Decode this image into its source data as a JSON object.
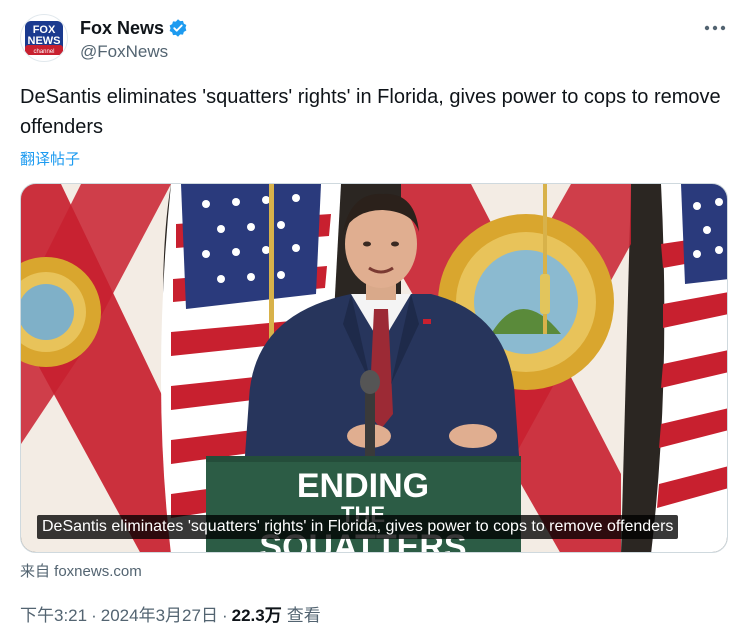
{
  "account": {
    "display_name": "Fox News",
    "handle": "@FoxNews",
    "avatar_logo_lines": [
      "FOX",
      "NEWS",
      "channel"
    ]
  },
  "tweet": {
    "text": "DeSantis eliminates 'squatters' rights' in Florida, gives power to cops to remove offenders",
    "translate_label": "翻译帖子"
  },
  "media": {
    "podium_sign_lines": [
      "ENDING",
      "THE",
      "SQUATTERS"
    ],
    "caption": "DeSantis eliminates 'squatters' rights' in Florida, gives power to cops to remove offenders",
    "source_label": "来自 foxnews.com"
  },
  "meta": {
    "time": "下午3:21",
    "separator": "·",
    "date": "2024年3月27日",
    "views_count": "22.3万",
    "views_label": "查看"
  },
  "colors": {
    "accent": "#1d9bf0",
    "secondary_text": "#536471",
    "florida_red": "#c8202f",
    "navy": "#27355c",
    "podium_green": "#2c5c45"
  },
  "icons": {
    "verified": "verified-badge-icon",
    "more": "more-options-icon"
  }
}
